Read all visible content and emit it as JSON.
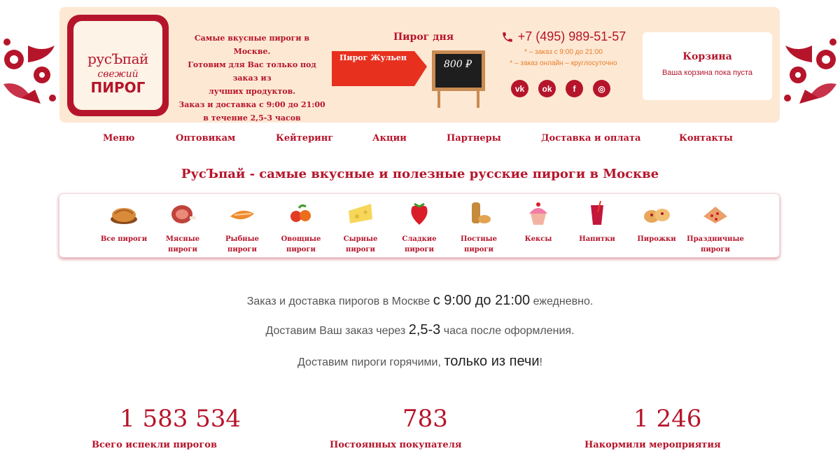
{
  "logo": {
    "line1": "русЪпай",
    "line2": "свежий",
    "line3": "ПИРОГ"
  },
  "tagline": [
    "Самые вкусные пироги в Москве.",
    "Готовим для Вас только под заказ из",
    "лучших продуктов.",
    "Заказ и доставка с 9:00 до 21:00",
    "в течение 2,5-3 часов"
  ],
  "pie_of_day": {
    "title": "Пирог дня",
    "name": "Пирог Жульен",
    "price": "800 ₽"
  },
  "contact": {
    "phone": "+7 (495) 989-51-57",
    "note1": "* – заказ с 9:00 до 21:00",
    "note2": "* – заказ онлайн – круглосуточно",
    "socials": [
      {
        "icon": "vk-icon",
        "glyph": "vk"
      },
      {
        "icon": "odnoklassniki-icon",
        "glyph": "ok"
      },
      {
        "icon": "facebook-icon",
        "glyph": "f"
      },
      {
        "icon": "instagram-icon",
        "glyph": "◎"
      }
    ]
  },
  "cart": {
    "title": "Корзина",
    "note": "Ваша корзина пока пуста"
  },
  "nav": [
    "Меню",
    "Оптовикам",
    "Кейтеринг",
    "Акции",
    "Партнеры",
    "Доставка и оплата",
    "Контакты"
  ],
  "main_title": "РусЪпай - самые вкусные и полезные русские пироги в Москве",
  "categories": [
    {
      "icon": "pie-icon",
      "label": "Все пироги"
    },
    {
      "icon": "meat-icon",
      "label": "Мясные\nпироги"
    },
    {
      "icon": "fish-icon",
      "label": "Рыбные\nпироги"
    },
    {
      "icon": "vegetables-icon",
      "label": "Овощные\nпироги"
    },
    {
      "icon": "cheese-icon",
      "label": "Сырные\nпироги"
    },
    {
      "icon": "strawberry-icon",
      "label": "Сладкие\nпироги"
    },
    {
      "icon": "lenten-icon",
      "label": "Постные\nпироги"
    },
    {
      "icon": "cupcake-icon",
      "label": "Кексы"
    },
    {
      "icon": "drink-icon",
      "label": "Напитки"
    },
    {
      "icon": "pastry-icon",
      "label": "Пирожки"
    },
    {
      "icon": "festive-pie-icon",
      "label": "Праздничные\nпироги"
    }
  ],
  "info": {
    "l1_pre": "Заказ и доставка пирогов в Москве ",
    "l1_strong": "с 9:00 до 21:00",
    "l1_post": " ежедневно.",
    "l2_pre": "Доставим Ваш заказ через ",
    "l2_strong": "2,5-3",
    "l2_post": " часа после оформления.",
    "l3_pre": "Доставим пироги горячими, ",
    "l3_strong": "только из печи",
    "l3_post": "!"
  },
  "stats": [
    {
      "value": "1 583 534",
      "label": "Всего испекли пирогов"
    },
    {
      "value": "783",
      "label": "Постоянных покупателя"
    },
    {
      "value": "1 246",
      "label": "Накормили мероприятия"
    }
  ],
  "colors": {
    "brand": "#b5152b",
    "header_bg": "#fde8d3",
    "accent_orange": "#e87e2d",
    "banner_red": "#e8301f"
  }
}
